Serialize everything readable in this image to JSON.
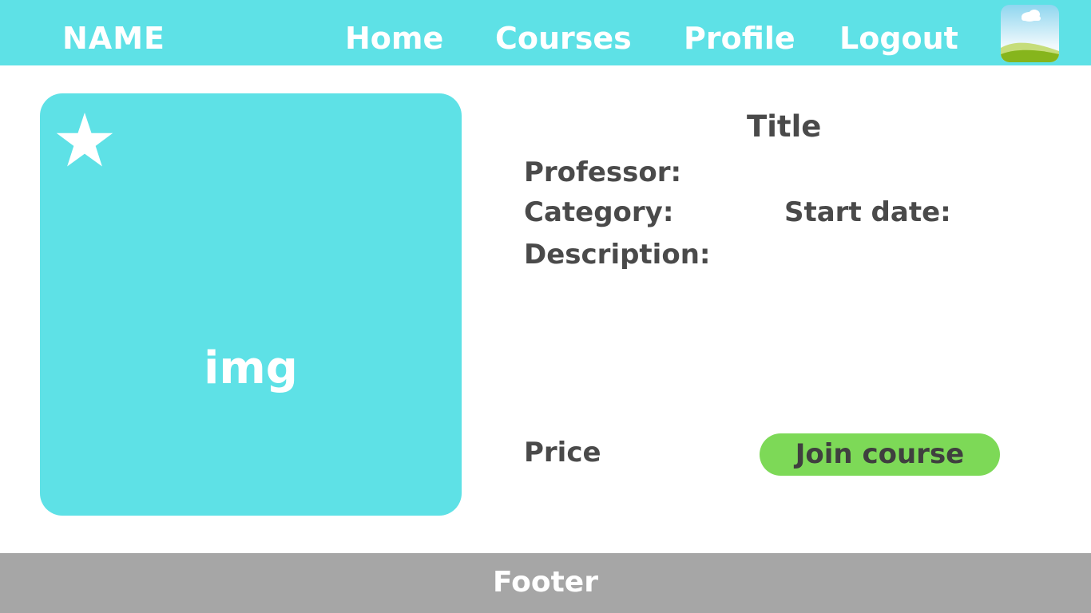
{
  "navbar": {
    "brand": "NAME",
    "links": {
      "home": "Home",
      "courses": "Courses",
      "profile": "Profile",
      "logout": "Logout"
    },
    "avatar_icon": "landscape-placeholder-icon",
    "background_color": "#5ee1e6"
  },
  "course": {
    "image_placeholder": "img",
    "favorite_icon": "star-icon",
    "title": "Title",
    "professor_label": "Professor:",
    "category_label": "Category:",
    "start_date_label": "Start date:",
    "description_label": "Description:",
    "price_label": "Price",
    "join_button_label": "Join course",
    "card_color": "#5ee1e6",
    "button_color": "#7dd957"
  },
  "footer": {
    "label": "Footer",
    "background_color": "#a6a6a6"
  }
}
